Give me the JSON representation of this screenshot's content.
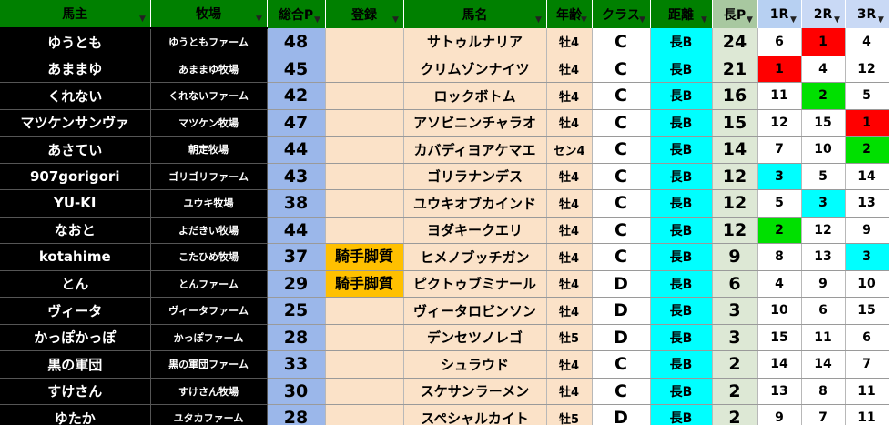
{
  "headers": {
    "owner": "馬主",
    "farm": "牧場",
    "total": "総合P",
    "registration": "登録",
    "horse": "馬名",
    "age": "年齢",
    "class": "クラス",
    "distance": "距離",
    "points": "長P",
    "r1": "1R",
    "r2": "2R",
    "r3": "3R"
  },
  "rows": [
    {
      "owner": "ゆうとも",
      "farm": "ゆうともファーム",
      "total": "48",
      "reg": "",
      "horse": "サトゥルナリア",
      "age": "牡4",
      "class": "C",
      "dist": "長B",
      "pts": "24",
      "r1": "6",
      "r2": "1",
      "r3": "4",
      "r1c": "",
      "r2c": "red",
      "r3c": ""
    },
    {
      "owner": "あままゆ",
      "farm": "あままゆ牧場",
      "total": "45",
      "reg": "",
      "horse": "クリムゾンナイツ",
      "age": "牡4",
      "class": "C",
      "dist": "長B",
      "pts": "21",
      "r1": "1",
      "r2": "4",
      "r3": "12",
      "r1c": "red",
      "r2c": "",
      "r3c": ""
    },
    {
      "owner": "くれない",
      "farm": "くれないファーム",
      "total": "42",
      "reg": "",
      "horse": "ロックボトム",
      "age": "牡4",
      "class": "C",
      "dist": "長B",
      "pts": "16",
      "r1": "11",
      "r2": "2",
      "r3": "5",
      "r1c": "",
      "r2c": "green",
      "r3c": ""
    },
    {
      "owner": "マツケンサンヴァ",
      "farm": "マツケン牧場",
      "total": "47",
      "reg": "",
      "horse": "アソビニンチャラオ",
      "age": "牡4",
      "class": "C",
      "dist": "長B",
      "pts": "15",
      "r1": "12",
      "r2": "15",
      "r3": "1",
      "r1c": "",
      "r2c": "",
      "r3c": "red"
    },
    {
      "owner": "あさてい",
      "farm": "朝定牧場",
      "total": "44",
      "reg": "",
      "horse": "カバディヨアケマエ",
      "age": "セン4",
      "class": "C",
      "dist": "長B",
      "pts": "14",
      "r1": "7",
      "r2": "10",
      "r3": "2",
      "r1c": "",
      "r2c": "",
      "r3c": "green"
    },
    {
      "owner": "907gorigori",
      "farm": "ゴリゴリファーム",
      "total": "43",
      "reg": "",
      "horse": "ゴリラナンデス",
      "age": "牡4",
      "class": "C",
      "dist": "長B",
      "pts": "12",
      "r1": "3",
      "r2": "5",
      "r3": "14",
      "r1c": "cyan",
      "r2c": "",
      "r3c": ""
    },
    {
      "owner": "YU-KI",
      "farm": "ユウキ牧場",
      "total": "38",
      "reg": "",
      "horse": "ユウキオブカインド",
      "age": "牡4",
      "class": "C",
      "dist": "長B",
      "pts": "12",
      "r1": "5",
      "r2": "3",
      "r3": "13",
      "r1c": "",
      "r2c": "cyan",
      "r3c": ""
    },
    {
      "owner": "なおと",
      "farm": "よだきい牧場",
      "total": "44",
      "reg": "",
      "horse": "ヨダキークエリ",
      "age": "牡4",
      "class": "C",
      "dist": "長B",
      "pts": "12",
      "r1": "2",
      "r2": "12",
      "r3": "9",
      "r1c": "green",
      "r2c": "",
      "r3c": ""
    },
    {
      "owner": "kotahime",
      "farm": "こたひめ牧場",
      "total": "37",
      "reg": "騎手脚質",
      "horse": "ヒメノブッチガン",
      "age": "牡4",
      "class": "C",
      "dist": "長B",
      "pts": "9",
      "r1": "8",
      "r2": "13",
      "r3": "3",
      "r1c": "",
      "r2c": "",
      "r3c": "cyan"
    },
    {
      "owner": "とん",
      "farm": "とんファーム",
      "total": "29",
      "reg": "騎手脚質",
      "horse": "ピクトゥブミナール",
      "age": "牡4",
      "class": "D",
      "dist": "長B",
      "pts": "6",
      "r1": "4",
      "r2": "9",
      "r3": "10",
      "r1c": "",
      "r2c": "",
      "r3c": ""
    },
    {
      "owner": "ヴィータ",
      "farm": "ヴィータファーム",
      "total": "25",
      "reg": "",
      "horse": "ヴィータロビンソン",
      "age": "牡4",
      "class": "D",
      "dist": "長B",
      "pts": "3",
      "r1": "10",
      "r2": "6",
      "r3": "15",
      "r1c": "",
      "r2c": "",
      "r3c": ""
    },
    {
      "owner": "かっぽかっぽ",
      "farm": "かっぽファーム",
      "total": "28",
      "reg": "",
      "horse": "デンセツノレゴ",
      "age": "牡5",
      "class": "D",
      "dist": "長B",
      "pts": "3",
      "r1": "15",
      "r2": "11",
      "r3": "6",
      "r1c": "",
      "r2c": "",
      "r3c": ""
    },
    {
      "owner": "黒の軍団",
      "farm": "黒の軍団ファーム",
      "total": "33",
      "reg": "",
      "horse": "シュラウド",
      "age": "牡4",
      "class": "C",
      "dist": "長B",
      "pts": "2",
      "r1": "14",
      "r2": "14",
      "r3": "7",
      "r1c": "",
      "r2c": "",
      "r3c": ""
    },
    {
      "owner": "すけさん",
      "farm": "すけさん牧場",
      "total": "30",
      "reg": "",
      "horse": "スケサンラーメン",
      "age": "牡4",
      "class": "C",
      "dist": "長B",
      "pts": "2",
      "r1": "13",
      "r2": "8",
      "r3": "11",
      "r1c": "",
      "r2c": "",
      "r3c": ""
    },
    {
      "owner": "ゆたか",
      "farm": "ユタカファーム",
      "total": "28",
      "reg": "",
      "horse": "スペシャルカイト",
      "age": "牡5",
      "class": "D",
      "dist": "長B",
      "pts": "2",
      "r1": "9",
      "r2": "7",
      "r3": "11",
      "r1c": "",
      "r2c": "",
      "r3c": ""
    }
  ],
  "colors": {
    "header_green": "#008000",
    "owner_bg": "#000000",
    "total_bg": "#9bb7ea",
    "horse_bg": "#fbe2c8",
    "dist_bg": "#00ffff",
    "pts_bg": "#dde8d5",
    "reg_badge": "#ffc000",
    "first_place": "#ff0000",
    "second_place": "#00e000",
    "third_place": "#00ffff"
  },
  "icons": {
    "filter": "filter-dropdown-icon",
    "filter_active": "filter-funnel-icon"
  }
}
